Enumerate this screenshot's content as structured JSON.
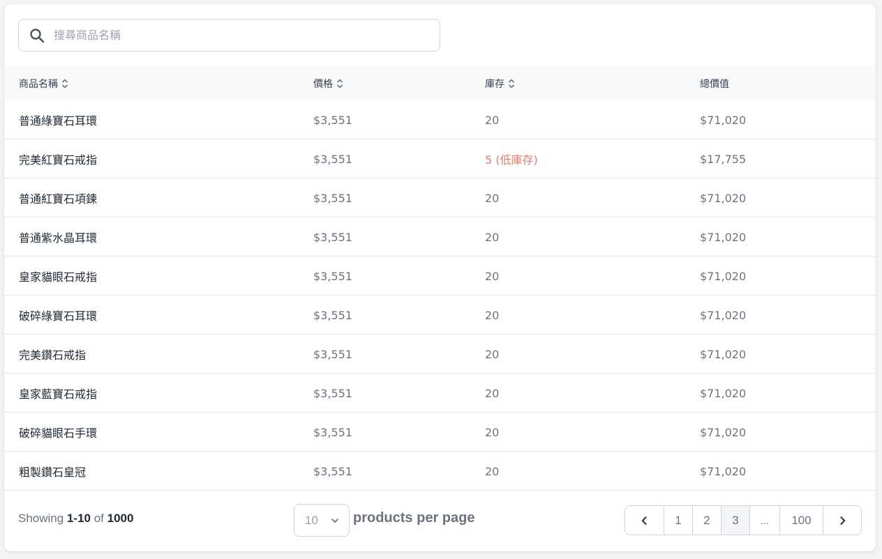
{
  "search": {
    "placeholder": "搜尋商品名稱",
    "value": ""
  },
  "table": {
    "headers": {
      "name": "商品名稱",
      "price": "價格",
      "stock": "庫存",
      "total": "總價值"
    },
    "rows": [
      {
        "name": "普通綠寶石耳環",
        "price": "$3,551",
        "stock": "20",
        "total": "$71,020",
        "low": false
      },
      {
        "name": "完美紅寶石戒指",
        "price": "$3,551",
        "stock": "5 (低庫存)",
        "total": "$17,755",
        "low": true
      },
      {
        "name": "普通紅寶石項鍊",
        "price": "$3,551",
        "stock": "20",
        "total": "$71,020",
        "low": false
      },
      {
        "name": "普通紫水晶耳環",
        "price": "$3,551",
        "stock": "20",
        "total": "$71,020",
        "low": false
      },
      {
        "name": "皇家貓眼石戒指",
        "price": "$3,551",
        "stock": "20",
        "total": "$71,020",
        "low": false
      },
      {
        "name": "破碎綠寶石耳環",
        "price": "$3,551",
        "stock": "20",
        "total": "$71,020",
        "low": false
      },
      {
        "name": "完美鑽石戒指",
        "price": "$3,551",
        "stock": "20",
        "total": "$71,020",
        "low": false
      },
      {
        "name": "皇家藍寶石戒指",
        "price": "$3,551",
        "stock": "20",
        "total": "$71,020",
        "low": false
      },
      {
        "name": "破碎貓眼石手環",
        "price": "$3,551",
        "stock": "20",
        "total": "$71,020",
        "low": false
      },
      {
        "name": "粗製鑽石皇冠",
        "price": "$3,551",
        "stock": "20",
        "total": "$71,020",
        "low": false
      }
    ]
  },
  "footer": {
    "showing_prefix": "Showing",
    "showing_range": "1-10",
    "showing_of": "of",
    "showing_total": "1000",
    "per_page_value": "10",
    "per_page_label": "products per page"
  },
  "pagination": {
    "pages": [
      "1",
      "2",
      "3",
      "...",
      "100"
    ],
    "active": "3"
  },
  "colors": {
    "low_stock": "#e07a6e",
    "header_bg": "#f8f9fa",
    "muted_text": "#6b7280"
  }
}
